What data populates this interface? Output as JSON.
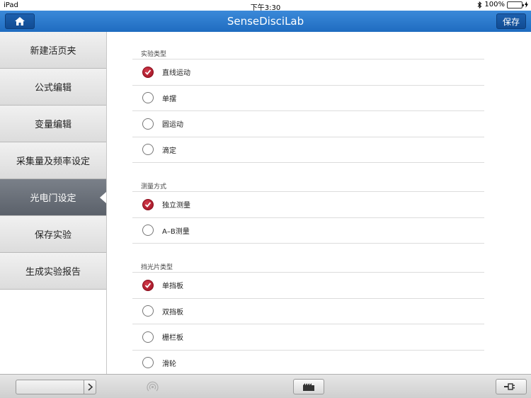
{
  "status_bar": {
    "device": "iPad",
    "time": "下午3:30",
    "battery": "100%",
    "battery_level": 1.0
  },
  "navbar": {
    "title": "SenseDisciLab",
    "save_label": "保存"
  },
  "sidebar": {
    "items": [
      {
        "label": "新建活页夹",
        "active": false
      },
      {
        "label": "公式编辑",
        "active": false
      },
      {
        "label": "变量编辑",
        "active": false
      },
      {
        "label": "采集量及频率设定",
        "active": false
      },
      {
        "label": "光电门设定",
        "active": true
      },
      {
        "label": "保存实验",
        "active": false
      },
      {
        "label": "生成实验报告",
        "active": false
      }
    ]
  },
  "main": {
    "sections": [
      {
        "title": "实验类型",
        "options": [
          {
            "label": "直线运动",
            "checked": true
          },
          {
            "label": "单摆",
            "checked": false
          },
          {
            "label": "圆运动",
            "checked": false
          },
          {
            "label": "滴定",
            "checked": false
          }
        ]
      },
      {
        "title": "测量方式",
        "options": [
          {
            "label": "独立测量",
            "checked": true
          },
          {
            "label": "A–B测量",
            "checked": false
          }
        ]
      },
      {
        "title": "挡光片类型",
        "options": [
          {
            "label": "单挡板",
            "checked": true
          },
          {
            "label": "双挡板",
            "checked": false
          },
          {
            "label": "栅栏板",
            "checked": false
          },
          {
            "label": "滑轮",
            "checked": false
          }
        ]
      }
    ]
  },
  "colors": {
    "nav_blue": "#2b7acb",
    "check_red": "#9b1021",
    "sidebar_active": "#6a7079"
  },
  "icons": {
    "home": "home-icon",
    "bluetooth": "bluetooth-icon",
    "signal": "signal-icon",
    "video": "film-icon",
    "plug": "plug-icon"
  }
}
